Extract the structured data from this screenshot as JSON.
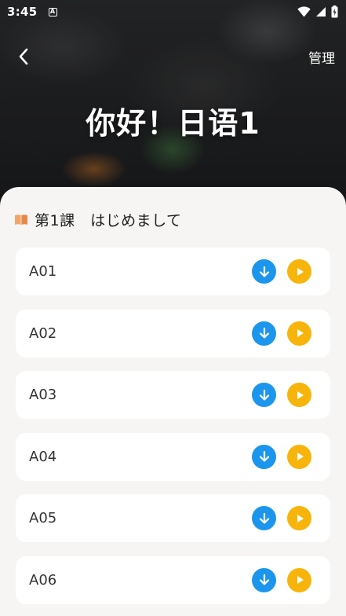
{
  "status_bar": {
    "time": "3:45",
    "notification_icon": "A"
  },
  "header": {
    "manage_label": "管理"
  },
  "hero": {
    "title": "你好！日语1"
  },
  "lesson": {
    "title": "第1課　はじめまして"
  },
  "items": [
    {
      "label": "A01"
    },
    {
      "label": "A02"
    },
    {
      "label": "A03"
    },
    {
      "label": "A04"
    },
    {
      "label": "A05"
    },
    {
      "label": "A06"
    }
  ],
  "colors": {
    "download": "#1c96ec",
    "play": "#f7b50b",
    "sheet_background": "#f6f5f3"
  },
  "icons": {
    "back": "chevron-left-icon",
    "lesson": "book-icon",
    "download": "download-icon",
    "play": "play-icon",
    "status": [
      "wifi-icon",
      "signal-icon",
      "battery-charging-icon"
    ]
  }
}
